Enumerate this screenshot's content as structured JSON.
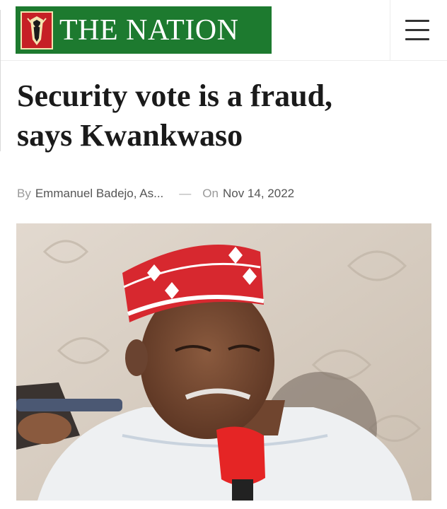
{
  "site": {
    "name": "THE NATION",
    "logo_icon": "nation-emblem-icon",
    "menu_icon": "hamburger-menu-icon"
  },
  "article": {
    "headline_line1": "Security vote is a fraud,",
    "headline_line2": "says Kwankwaso",
    "by_label": "By",
    "author": "Emmanuel Badejo, As...",
    "separator": "—",
    "on_label": "On",
    "date": "Nov 14, 2022",
    "image_icon": "article-photo"
  },
  "colors": {
    "brand_green": "#1d7a2f",
    "emblem_red": "#c62026",
    "headline": "#1a1a1a",
    "meta": "#9a9a9a"
  }
}
